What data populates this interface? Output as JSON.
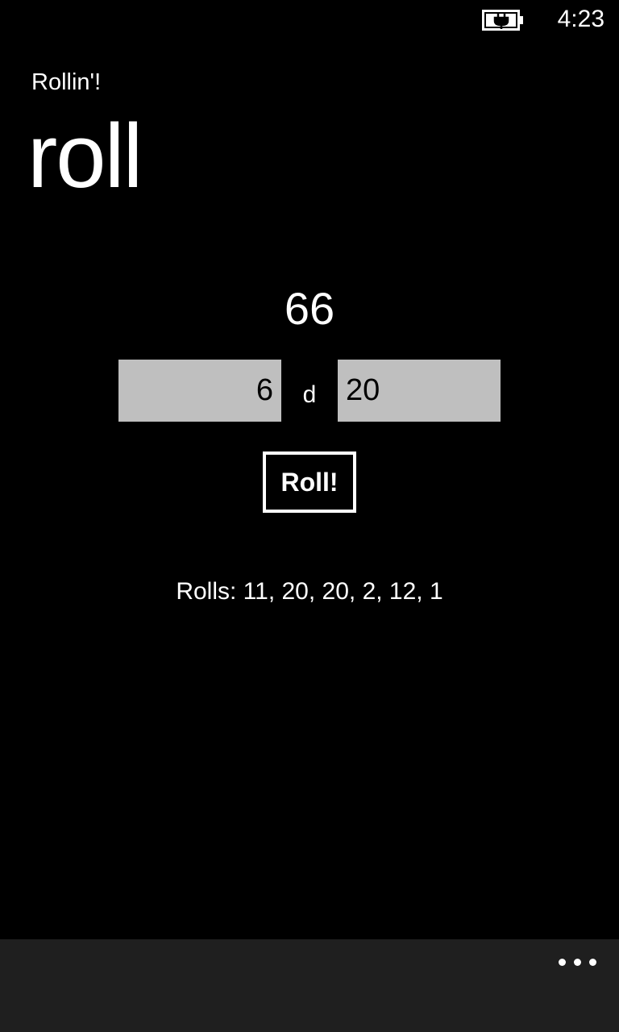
{
  "status_bar": {
    "time": "4:23",
    "battery_icon": "battery-charging-icon"
  },
  "header": {
    "app_title": "Rollin'!",
    "page_title": "roll"
  },
  "result": {
    "total": "66"
  },
  "dice": {
    "count": "6",
    "separator": "d",
    "sides": "20"
  },
  "actions": {
    "roll_label": "Roll!"
  },
  "rolls": {
    "text": "Rolls: 11, 20, 20, 2, 12, 1"
  },
  "app_bar": {
    "more_icon": "ellipsis-icon"
  },
  "colors": {
    "background": "#000000",
    "input_background": "#bfbfbf",
    "app_bar_background": "#1f1f1f",
    "foreground": "#ffffff"
  }
}
